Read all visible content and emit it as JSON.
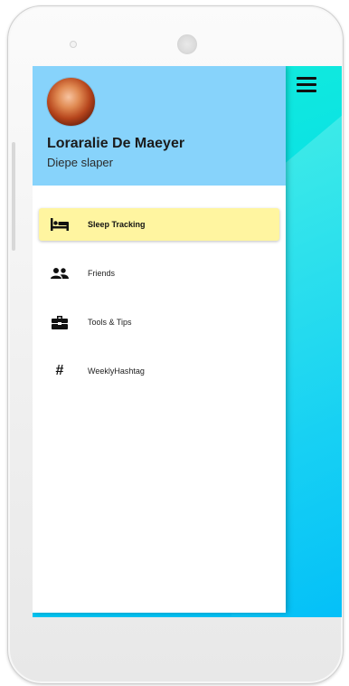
{
  "user": {
    "name": "Loraralie De Maeyer",
    "status": "Diepe slaper"
  },
  "nav": {
    "items": [
      {
        "label": "Sleep Tracking",
        "icon": "bed-icon",
        "active": true
      },
      {
        "label": "Friends",
        "icon": "people-icon",
        "active": false
      },
      {
        "label": "Tools & Tips",
        "icon": "toolbox-icon",
        "active": false
      },
      {
        "label": "WeeklyHashtag",
        "icon": "hashtag-icon",
        "active": false
      }
    ],
    "hashtag_glyph": "#"
  },
  "colors": {
    "header": "#87d3fb",
    "active_item": "#fff5a0",
    "screen_gradient_start": "#14f0d8",
    "screen_gradient_end": "#00bff8"
  }
}
